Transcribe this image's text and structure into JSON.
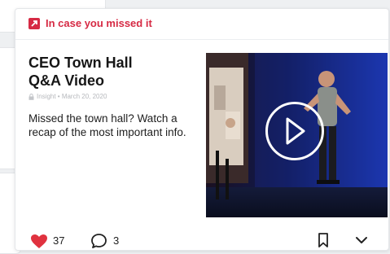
{
  "header": {
    "label": "In case you missed it",
    "accent_color": "#d62a44",
    "icon": "bookmark-flag-icon"
  },
  "post": {
    "title_line1": "CEO Town Hall",
    "title_line2": "Q&A Video",
    "meta": "Insight • March 20, 2020",
    "description": "Missed the town hall? Watch a recap of the most important info."
  },
  "media": {
    "type": "video",
    "play_icon": "play-icon"
  },
  "footer": {
    "likes": "37",
    "comments": "3",
    "heart_color": "#e0323f",
    "icons": [
      "heart-icon",
      "comment-icon",
      "bookmark-icon",
      "chevron-down-icon"
    ]
  }
}
